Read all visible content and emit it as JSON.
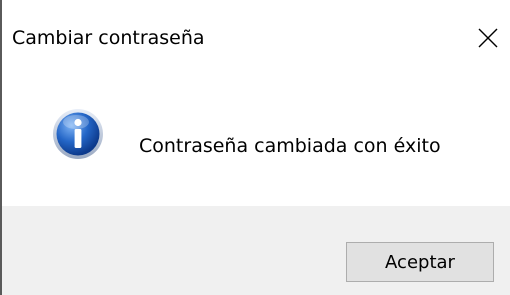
{
  "dialog": {
    "title": "Cambiar contraseña",
    "message": "Contraseña cambiada con éxito",
    "icon": "info-icon",
    "ok_label": "Aceptar",
    "close_icon": "close-icon"
  },
  "colors": {
    "footer_bg": "#f0f0f0",
    "button_bg": "#e1e1e1",
    "button_border": "#adadad",
    "icon_blue": "#1f5fbf"
  }
}
